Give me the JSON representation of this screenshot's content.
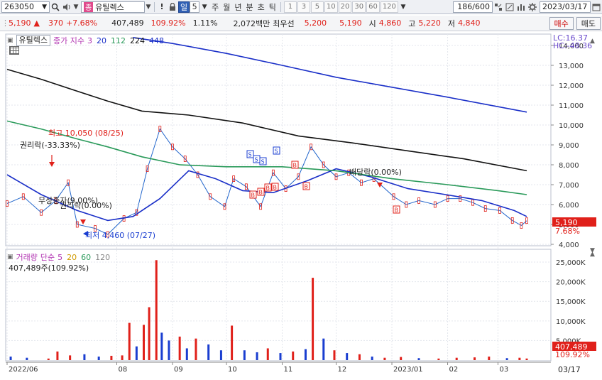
{
  "toolbar": {
    "code": "263050",
    "name_badge": "종",
    "name": "유틸렉스",
    "period_buttons": [
      "일",
      "5",
      "주",
      "월",
      "년",
      "분",
      "초",
      "틱"
    ],
    "period_selected": "일",
    "intervals": [
      "1",
      "3",
      "5",
      "10",
      "20",
      "30",
      "60",
      "120"
    ],
    "count": "186/600",
    "date": "2023/03/17"
  },
  "quote": {
    "price": "5,190",
    "change_arrow": "▲",
    "change": "370",
    "change_pct": "+7.68%",
    "volume": "407,489",
    "volume_ratio": "109.92%",
    "turnover": "1.11%",
    "amount": "2,072백만",
    "best_label": "최우선",
    "best_ask": "5,200",
    "best_bid": "5,190",
    "open_label": "시",
    "open": "4,860",
    "high_label": "고",
    "high": "5,220",
    "low_label": "저",
    "low": "4,840",
    "buy_label": "매수",
    "sell_label": "매도"
  },
  "price_panel": {
    "title": "유틸렉스",
    "ma_label": "종가 지수",
    "ma_periods": [
      {
        "value": "3",
        "color": "#b030b0"
      },
      {
        "value": "20",
        "color": "#1a2fc8"
      },
      {
        "value": "112",
        "color": "#2a9a5a"
      },
      {
        "value": "224",
        "color": "#111111"
      },
      {
        "value": "448",
        "color": "#1a2fc8"
      }
    ],
    "lc": "LC:16.37",
    "hc": "HC:-48.36",
    "y_ticks": [
      "14,000",
      "13,000",
      "12,000",
      "11,000",
      "10,000",
      "9,000",
      "8,000",
      "7,000",
      "6,000",
      "5,000",
      "4,000"
    ],
    "last_price": "5,190",
    "last_pct": "7.68%",
    "annotations": {
      "high": "최고 10,050 (08/25)",
      "low": "최저 4,460 (07/27)",
      "rights": "권리락(-33.33%)",
      "rights2": "권리락(0.00%)",
      "free": "무상증자(9.00%)",
      "dividend": "배당락(0.00%)"
    }
  },
  "volume_panel": {
    "title": "거래량",
    "ma_label": "단순",
    "ma_periods": [
      {
        "value": "5",
        "color": "#b030b0"
      },
      {
        "value": "20",
        "color": "#d09a00"
      },
      {
        "value": "60",
        "color": "#2a9a5a"
      },
      {
        "value": "120",
        "color": "#888888"
      }
    ],
    "readout": "407,489주(109.92%)",
    "y_ticks": [
      "25,000K",
      "20,000K",
      "15,000K",
      "10,000K",
      "5,000K"
    ],
    "last_volume": "407,489",
    "last_pct": "109.92%"
  },
  "x_axis": {
    "labels": [
      "2022/06",
      "08",
      "09",
      "10",
      "11",
      "12",
      "2023/01",
      "02",
      "03"
    ],
    "right_date": "03/17"
  },
  "chart_data": {
    "type": "line",
    "x_range": [
      "2022-06-01",
      "2023-03-17"
    ],
    "ylim": [
      4000,
      14500
    ],
    "series": [
      {
        "key": "close",
        "color": "#2266cc",
        "points": [
          [
            "2022-06-01",
            6050
          ],
          [
            "2022-06-10",
            6400
          ],
          [
            "2022-06-20",
            5600
          ],
          [
            "2022-06-28",
            6200
          ],
          [
            "2022-07-05",
            7100
          ],
          [
            "2022-07-10",
            5000
          ],
          [
            "2022-07-20",
            4800
          ],
          [
            "2022-07-27",
            4500
          ],
          [
            "2022-08-05",
            5300
          ],
          [
            "2022-08-12",
            5600
          ],
          [
            "2022-08-18",
            7800
          ],
          [
            "2022-08-25",
            9800
          ],
          [
            "2022-09-01",
            8900
          ],
          [
            "2022-09-08",
            8300
          ],
          [
            "2022-09-15",
            7500
          ],
          [
            "2022-09-22",
            6400
          ],
          [
            "2022-09-30",
            5900
          ],
          [
            "2022-10-05",
            7300
          ],
          [
            "2022-10-12",
            6900
          ],
          [
            "2022-10-20",
            5900
          ],
          [
            "2022-10-27",
            7600
          ],
          [
            "2022-11-03",
            6800
          ],
          [
            "2022-11-10",
            7400
          ],
          [
            "2022-11-17",
            8900
          ],
          [
            "2022-11-24",
            8000
          ],
          [
            "2022-12-01",
            7400
          ],
          [
            "2022-12-08",
            7600
          ],
          [
            "2022-12-15",
            7100
          ],
          [
            "2022-12-22",
            7300
          ],
          [
            "2023-01-02",
            6400
          ],
          [
            "2023-01-09",
            6000
          ],
          [
            "2023-01-16",
            6200
          ],
          [
            "2023-01-25",
            6000
          ],
          [
            "2023-02-01",
            6300
          ],
          [
            "2023-02-08",
            6300
          ],
          [
            "2023-02-15",
            6100
          ],
          [
            "2023-02-22",
            5800
          ],
          [
            "2023-03-02",
            5700
          ],
          [
            "2023-03-09",
            5200
          ],
          [
            "2023-03-14",
            4950
          ],
          [
            "2023-03-17",
            5190
          ]
        ]
      },
      {
        "key": "ma20",
        "color": "#1a2fc8",
        "points": [
          [
            "2022-06-01",
            7500
          ],
          [
            "2022-06-20",
            6500
          ],
          [
            "2022-07-10",
            5700
          ],
          [
            "2022-07-27",
            5200
          ],
          [
            "2022-08-10",
            5400
          ],
          [
            "2022-08-25",
            6300
          ],
          [
            "2022-09-10",
            7700
          ],
          [
            "2022-09-25",
            7300
          ],
          [
            "2022-10-10",
            6700
          ],
          [
            "2022-10-27",
            6600
          ],
          [
            "2022-11-15",
            7200
          ],
          [
            "2022-12-01",
            7800
          ],
          [
            "2022-12-20",
            7400
          ],
          [
            "2023-01-10",
            6800
          ],
          [
            "2023-01-31",
            6500
          ],
          [
            "2023-02-20",
            6200
          ],
          [
            "2023-03-10",
            5700
          ],
          [
            "2023-03-17",
            5400
          ]
        ]
      },
      {
        "key": "ma112",
        "color": "#2a9a5a",
        "points": [
          [
            "2022-06-01",
            10200
          ],
          [
            "2022-06-20",
            9800
          ],
          [
            "2022-07-10",
            9300
          ],
          [
            "2022-07-27",
            8900
          ],
          [
            "2022-08-15",
            8400
          ],
          [
            "2022-09-05",
            8000
          ],
          [
            "2022-10-01",
            7900
          ],
          [
            "2022-11-01",
            7900
          ],
          [
            "2022-12-01",
            7700
          ],
          [
            "2023-01-01",
            7300
          ],
          [
            "2023-02-01",
            7000
          ],
          [
            "2023-03-01",
            6700
          ],
          [
            "2023-03-17",
            6500
          ]
        ]
      },
      {
        "key": "ma224",
        "color": "#111111",
        "points": [
          [
            "2022-06-01",
            12800
          ],
          [
            "2022-06-20",
            12300
          ],
          [
            "2022-07-10",
            11700
          ],
          [
            "2022-07-27",
            11200
          ],
          [
            "2022-08-15",
            10700
          ],
          [
            "2022-09-10",
            10500
          ],
          [
            "2022-10-10",
            10100
          ],
          [
            "2022-11-10",
            9450
          ],
          [
            "2022-12-10",
            9100
          ],
          [
            "2023-01-10",
            8700
          ],
          [
            "2023-02-10",
            8300
          ],
          [
            "2023-03-17",
            7700
          ]
        ]
      },
      {
        "key": "ma448",
        "color": "#1a2fc8",
        "points": [
          [
            "2022-08-10",
            14400
          ],
          [
            "2022-09-01",
            14100
          ],
          [
            "2022-10-01",
            13600
          ],
          [
            "2022-11-01",
            13000
          ],
          [
            "2022-12-01",
            12400
          ],
          [
            "2023-01-01",
            11900
          ],
          [
            "2023-02-01",
            11400
          ],
          [
            "2023-03-17",
            10650
          ]
        ]
      }
    ],
    "volume": {
      "ylim": [
        0,
        27000
      ],
      "unit": "K",
      "bars": [
        [
          "2022-06-03",
          900,
          "blue"
        ],
        [
          "2022-06-12",
          600,
          "blue"
        ],
        [
          "2022-06-24",
          400,
          "red"
        ],
        [
          "2022-06-29",
          2200,
          "red"
        ],
        [
          "2022-07-06",
          1200,
          "red"
        ],
        [
          "2022-07-14",
          1500,
          "blue"
        ],
        [
          "2022-07-22",
          900,
          "blue"
        ],
        [
          "2022-07-29",
          1100,
          "red"
        ],
        [
          "2022-08-04",
          1200,
          "red"
        ],
        [
          "2022-08-08",
          9500,
          "red"
        ],
        [
          "2022-08-12",
          3500,
          "blue"
        ],
        [
          "2022-08-16",
          9000,
          "red"
        ],
        [
          "2022-08-19",
          13500,
          "red"
        ],
        [
          "2022-08-23",
          25500,
          "red"
        ],
        [
          "2022-08-26",
          7000,
          "blue"
        ],
        [
          "2022-08-30",
          5000,
          "blue"
        ],
        [
          "2022-09-05",
          6000,
          "red"
        ],
        [
          "2022-09-09",
          3000,
          "blue"
        ],
        [
          "2022-09-14",
          5500,
          "red"
        ],
        [
          "2022-09-21",
          4000,
          "blue"
        ],
        [
          "2022-09-28",
          2500,
          "blue"
        ],
        [
          "2022-10-04",
          8800,
          "red"
        ],
        [
          "2022-10-11",
          2500,
          "blue"
        ],
        [
          "2022-10-18",
          2000,
          "blue"
        ],
        [
          "2022-10-24",
          3000,
          "red"
        ],
        [
          "2022-10-31",
          1800,
          "blue"
        ],
        [
          "2022-11-07",
          2200,
          "red"
        ],
        [
          "2022-11-14",
          2800,
          "blue"
        ],
        [
          "2022-11-18",
          21000,
          "red"
        ],
        [
          "2022-11-24",
          5500,
          "blue"
        ],
        [
          "2022-11-30",
          2500,
          "red"
        ],
        [
          "2022-12-07",
          1800,
          "blue"
        ],
        [
          "2022-12-14",
          1500,
          "red"
        ],
        [
          "2022-12-21",
          900,
          "blue"
        ],
        [
          "2022-12-28",
          600,
          "red"
        ],
        [
          "2023-01-06",
          800,
          "red"
        ],
        [
          "2023-01-16",
          500,
          "blue"
        ],
        [
          "2023-01-27",
          400,
          "red"
        ],
        [
          "2023-02-06",
          600,
          "red"
        ],
        [
          "2023-02-16",
          700,
          "red"
        ],
        [
          "2023-02-24",
          900,
          "red"
        ],
        [
          "2023-03-06",
          500,
          "blue"
        ],
        [
          "2023-03-13",
          600,
          "red"
        ],
        [
          "2023-03-17",
          407,
          "red"
        ]
      ]
    }
  }
}
